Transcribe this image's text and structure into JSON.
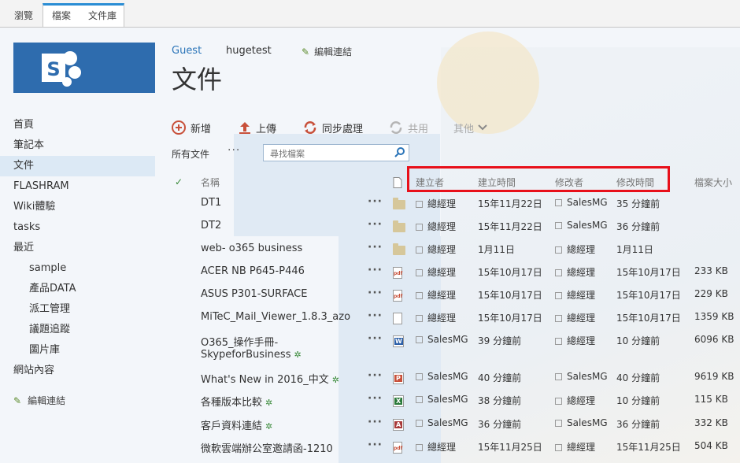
{
  "ribbon": {
    "browse": "瀏覽",
    "files": "檔案",
    "library": "文件庫"
  },
  "header": {
    "guest": "Guest",
    "site": "hugetest",
    "edit_links": "編輯連結",
    "title": "文件"
  },
  "nav": {
    "items": [
      {
        "label": "首頁",
        "sub": false,
        "active": false
      },
      {
        "label": "筆記本",
        "sub": false,
        "active": false
      },
      {
        "label": "文件",
        "sub": false,
        "active": true
      },
      {
        "label": "FLASHRAM",
        "sub": false,
        "active": false
      },
      {
        "label": "Wiki體驗",
        "sub": false,
        "active": false
      },
      {
        "label": "tasks",
        "sub": false,
        "active": false
      },
      {
        "label": "最近",
        "sub": false,
        "active": false
      },
      {
        "label": "sample",
        "sub": true,
        "active": false
      },
      {
        "label": "產品DATA",
        "sub": true,
        "active": false
      },
      {
        "label": "派工管理",
        "sub": true,
        "active": false
      },
      {
        "label": "議題追蹤",
        "sub": true,
        "active": false
      },
      {
        "label": "圖片庫",
        "sub": true,
        "active": false
      },
      {
        "label": "網站內容",
        "sub": false,
        "active": false
      }
    ],
    "edit_links": "編輯連結"
  },
  "toolbar": {
    "new": "新增",
    "upload": "上傳",
    "sync": "同步處理",
    "share": "共用",
    "more": "其他"
  },
  "view": {
    "all_docs": "所有文件",
    "more": "···"
  },
  "search": {
    "placeholder": "尋找檔案"
  },
  "columns": {
    "name": "名稱",
    "created_by": "建立者",
    "created": "建立時間",
    "modified_by": "修改者",
    "modified": "修改時間",
    "size": "檔案大小"
  },
  "rows": [
    {
      "name": "DT1",
      "icon": "folder",
      "created_by": "總經理",
      "created": "15年11月22日",
      "modified_by": "SalesMG",
      "modified": "35 分鐘前",
      "size": "",
      "is_new": false
    },
    {
      "name": "DT2",
      "icon": "folder",
      "created_by": "總經理",
      "created": "15年11月22日",
      "modified_by": "SalesMG",
      "modified": "36 分鐘前",
      "size": "",
      "is_new": false
    },
    {
      "name": "web- o365 business",
      "icon": "folder",
      "created_by": "總經理",
      "created": "1月11日",
      "modified_by": "總經理",
      "modified": "1月11日",
      "size": "",
      "is_new": false
    },
    {
      "name": "ACER NB P645-P446",
      "icon": "pdf",
      "created_by": "總經理",
      "created": "15年10月17日",
      "modified_by": "總經理",
      "modified": "15年10月17日",
      "size": "233 KB",
      "is_new": false
    },
    {
      "name": "ASUS P301-SURFACE",
      "icon": "pdf",
      "created_by": "總經理",
      "created": "15年10月17日",
      "modified_by": "總經理",
      "modified": "15年10月17日",
      "size": "229 KB",
      "is_new": false
    },
    {
      "name": "MiTeC_Mail_Viewer_1.8.3_azo",
      "icon": "generic",
      "created_by": "總經理",
      "created": "15年10月17日",
      "modified_by": "總經理",
      "modified": "15年10月17日",
      "size": "1359 KB",
      "is_new": false
    },
    {
      "name": "O365_操作手冊-",
      "name2": "SkypeforBusiness",
      "icon": "word",
      "created_by": "SalesMG",
      "created": "39 分鐘前",
      "modified_by": "總經理",
      "modified": "10 分鐘前",
      "size": "6096 KB",
      "is_new": true
    },
    {
      "name": "What's New in 2016_中文",
      "icon": "ppt",
      "created_by": "SalesMG",
      "created": "40 分鐘前",
      "modified_by": "SalesMG",
      "modified": "40 分鐘前",
      "size": "9619 KB",
      "is_new": true
    },
    {
      "name": "各種版本比較",
      "icon": "xls",
      "created_by": "SalesMG",
      "created": "38 分鐘前",
      "modified_by": "總經理",
      "modified": "10 分鐘前",
      "size": "115 KB",
      "is_new": true
    },
    {
      "name": "客戶資料連結",
      "icon": "acc",
      "created_by": "SalesMG",
      "created": "36 分鐘前",
      "modified_by": "SalesMG",
      "modified": "36 分鐘前",
      "size": "332 KB",
      "is_new": true
    },
    {
      "name": "微軟雲端辦公室邀請函-1210",
      "icon": "pdf",
      "created_by": "總經理",
      "created": "15年11月25日",
      "modified_by": "總經理",
      "modified": "15年11月25日",
      "size": "504 KB",
      "is_new": false
    }
  ],
  "colors": {
    "accent": "#2a8dd4",
    "logo_bg": "#2e6cae",
    "highlight": "#e8101a",
    "new_marker": "#3a8a3a"
  }
}
